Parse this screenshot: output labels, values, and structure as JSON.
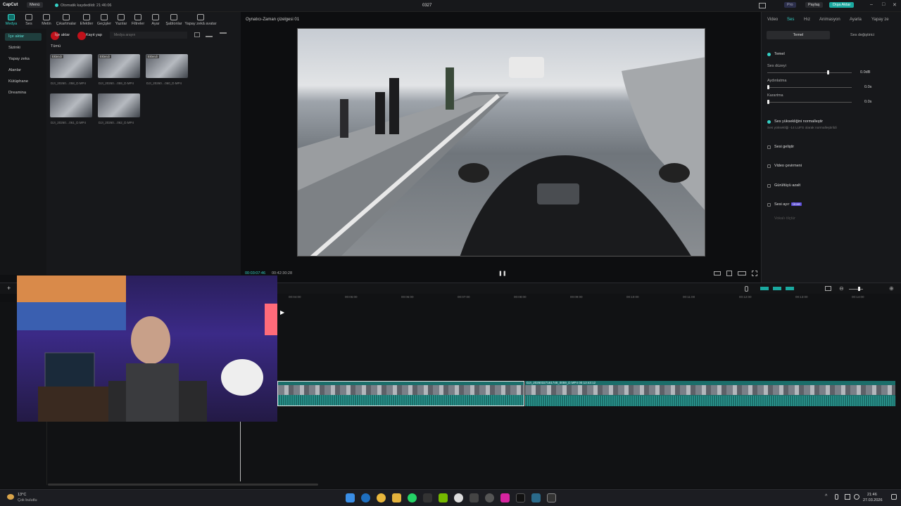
{
  "titlebar": {
    "app": "CapCut",
    "menu": "Menü",
    "autosave": "Otomatik kaydedildi: 21:46:06",
    "project": "0327",
    "pro": "Pro",
    "share": "Paylaş",
    "export": "Dışa Aktar"
  },
  "toolbar": {
    "items": [
      "Medya",
      "Ses",
      "Metin",
      "Çıkartmalar",
      "Efektler",
      "Geçişler",
      "Yazılar",
      "Filtreler",
      "Ayar",
      "Şablonlar",
      "Yapay zekâ avatar"
    ]
  },
  "leftnav": {
    "items": [
      "İçe aktar",
      "Sizinki",
      "Yapay zeka",
      "Alanlar",
      "Kütüphane",
      "Dreamina"
    ]
  },
  "media": {
    "import": "İçe aktar",
    "record": "Kayıt yap",
    "search_placeholder": "Medya arayın",
    "all": "Tümü",
    "badge": "Eklendi",
    "files": [
      "DJI_20260…058_D.MP4",
      "DJI_20260…059_D.MP4",
      "DJI_20260…060_D.MP4",
      "DJI_20260…061_D.MP4",
      "DJI_20260…062_D.MP4"
    ]
  },
  "player": {
    "title": "Oynatıcı-Zaman çizelgesi 01",
    "current": "00:03:07:46",
    "total": "00:42:30:28"
  },
  "right": {
    "tabs": [
      "Video",
      "Ses",
      "Hız",
      "Animasyon",
      "Ayarla",
      "Yapay ze"
    ],
    "subtabs": [
      "Temel",
      "Ses değiştirici"
    ],
    "section": "Temel",
    "volume_label": "Ses düzeyi",
    "volume_value": "0.0dB",
    "fadein_label": "Aydınlatma",
    "fadein_value": "0.0s",
    "fadeout_label": "Karartma",
    "fadeout_value": "0.0s",
    "normalize": "Ses yüksekliğini normalleştir",
    "normalize_desc": "Ses yüksekliği -14 LUFS olarak normalleştirildi",
    "enhance": "Sesi geliştir",
    "v2t": "Video çevirmeni",
    "noise": "Gürültüyü azalt",
    "separate": "Sesi ayır",
    "separate_badge": "Ücret",
    "voice": "Vokalı ölçtür"
  },
  "timeline": {
    "ticks": [
      "00:04:00",
      "00:06:00",
      "00:06:00",
      "00:07:00",
      "00:08:00",
      "00:09:00",
      "00:10:00",
      "00:11:00",
      "00:12:00",
      "00:13:00",
      "00:14:00"
    ],
    "clip2": "DJI_20260327161748_0059_D.MP4   00:13:43:12"
  },
  "taskbar": {
    "temp": "13°C",
    "weather": "Çok bulutlu",
    "time": "21:46",
    "date": "27.03.2026"
  }
}
